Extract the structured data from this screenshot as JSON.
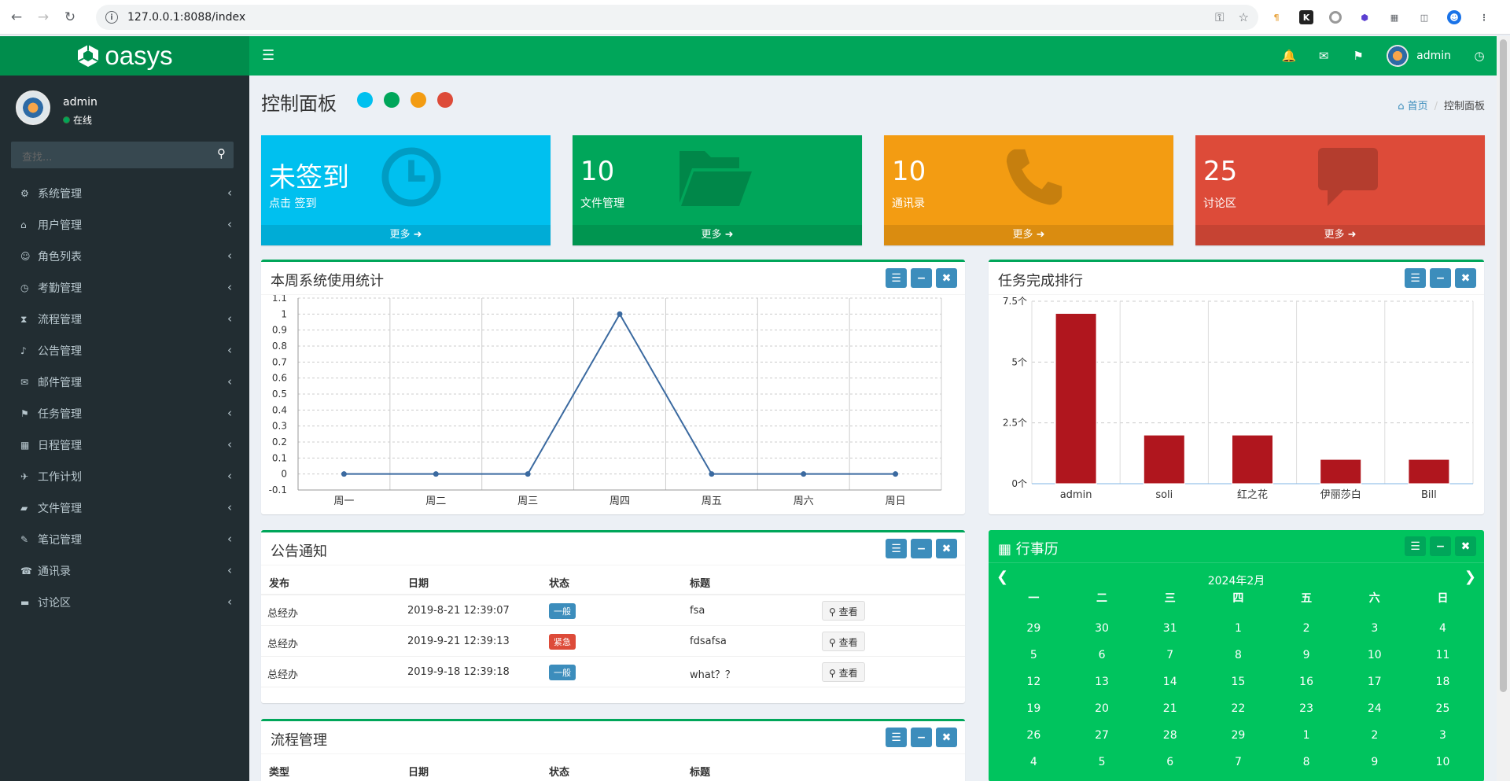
{
  "browser": {
    "url": "127.0.0.1:8088/index"
  },
  "app": {
    "brand": "oasys",
    "user": "admin"
  },
  "sidebar": {
    "user_name": "admin",
    "status": "在线",
    "search_placeholder": "查找...",
    "items": [
      {
        "label": "系统管理",
        "icon": "gear-icon"
      },
      {
        "label": "用户管理",
        "icon": "graduation-cap-icon"
      },
      {
        "label": "角色列表",
        "icon": "user-icon"
      },
      {
        "label": "考勤管理",
        "icon": "clock-icon"
      },
      {
        "label": "流程管理",
        "icon": "hourglass-icon"
      },
      {
        "label": "公告管理",
        "icon": "bell-icon"
      },
      {
        "label": "邮件管理",
        "icon": "envelope-icon"
      },
      {
        "label": "任务管理",
        "icon": "flag-icon"
      },
      {
        "label": "日程管理",
        "icon": "calendar-icon"
      },
      {
        "label": "工作计划",
        "icon": "plane-icon"
      },
      {
        "label": "文件管理",
        "icon": "folder-icon"
      },
      {
        "label": "笔记管理",
        "icon": "edit-icon"
      },
      {
        "label": "通讯录",
        "icon": "phone-icon"
      },
      {
        "label": "讨论区",
        "icon": "comment-icon"
      }
    ]
  },
  "header": {
    "title": "控制面板",
    "theme_colors": [
      "#00c0ef",
      "#00a65a",
      "#f39c12",
      "#dd4b39"
    ],
    "breadcrumb_home": "首页",
    "breadcrumb_current": "控制面板"
  },
  "cards": [
    {
      "value": "未签到",
      "label": "点击 签到",
      "more": "更多",
      "color": "#00c0ef",
      "icon": "clock-icon"
    },
    {
      "value": "10",
      "label": "文件管理",
      "more": "更多",
      "color": "#00a65a",
      "icon": "folder-open-icon"
    },
    {
      "value": "10",
      "label": "通讯录",
      "more": "更多",
      "color": "#f39c12",
      "icon": "phone-icon"
    },
    {
      "value": "25",
      "label": "讨论区",
      "more": "更多",
      "color": "#dd4b39",
      "icon": "comment-icon"
    }
  ],
  "usage_chart": {
    "title": "本周系统使用统计"
  },
  "ranking_chart": {
    "title": "任务完成排行"
  },
  "chart_data": [
    {
      "type": "line",
      "title": "本周系统使用统计",
      "x": [
        "周一",
        "周二",
        "周三",
        "周四",
        "周五",
        "周六",
        "周日"
      ],
      "y_ticks": [
        "1.1",
        "1",
        "0.9",
        "0.8",
        "0.7",
        "0.6",
        "0.5",
        "0.4",
        "0.3",
        "0.2",
        "0.1",
        "0",
        "-0.1"
      ],
      "series": [
        {
          "values": [
            0,
            0,
            0,
            1,
            0,
            0,
            0
          ],
          "color": "#3b6aa0"
        }
      ],
      "ylim": [
        -0.1,
        1.1
      ],
      "grid": true
    },
    {
      "type": "bar",
      "title": "任务完成排行",
      "categories": [
        "admin",
        "soli",
        "红之花",
        "伊丽莎白",
        "Bill"
      ],
      "values": [
        7,
        2,
        2,
        1,
        1
      ],
      "y_ticks": [
        "7.5个",
        "5个",
        "2.5个",
        "0个"
      ],
      "ylim": [
        0,
        7.5
      ],
      "color": "#b0161e",
      "grid": true
    }
  ],
  "notices": {
    "title": "公告通知",
    "columns": [
      "发布",
      "日期",
      "状态",
      "标题"
    ],
    "rows": [
      {
        "publisher": "总经办",
        "date": "2019-8-21 12:39:07",
        "status": "一般",
        "status_color": "#3c8dbc",
        "title": "fsa",
        "action": "查看"
      },
      {
        "publisher": "总经办",
        "date": "2019-9-21 12:39:13",
        "status": "紧急",
        "status_color": "#dd4b39",
        "title": "fdsafsa",
        "action": "查看"
      },
      {
        "publisher": "总经办",
        "date": "2019-9-18 12:39:18",
        "status": "一般",
        "status_color": "#3c8dbc",
        "title": "what？？",
        "action": "查看"
      }
    ]
  },
  "process": {
    "title": "流程管理",
    "columns": [
      "类型",
      "日期",
      "状态",
      "标题"
    ]
  },
  "calendar": {
    "title": "行事历",
    "month": "2024年2月",
    "weekdays": [
      "一",
      "二",
      "三",
      "四",
      "五",
      "六",
      "日"
    ],
    "weeks": [
      [
        "29",
        "30",
        "31",
        "1",
        "2",
        "3",
        "4"
      ],
      [
        "5",
        "6",
        "7",
        "8",
        "9",
        "10",
        "11"
      ],
      [
        "12",
        "13",
        "14",
        "15",
        "16",
        "17",
        "18"
      ],
      [
        "19",
        "20",
        "21",
        "22",
        "23",
        "24",
        "25"
      ],
      [
        "26",
        "27",
        "28",
        "29",
        "1",
        "2",
        "3"
      ],
      [
        "4",
        "5",
        "6",
        "7",
        "8",
        "9",
        "10"
      ]
    ]
  }
}
